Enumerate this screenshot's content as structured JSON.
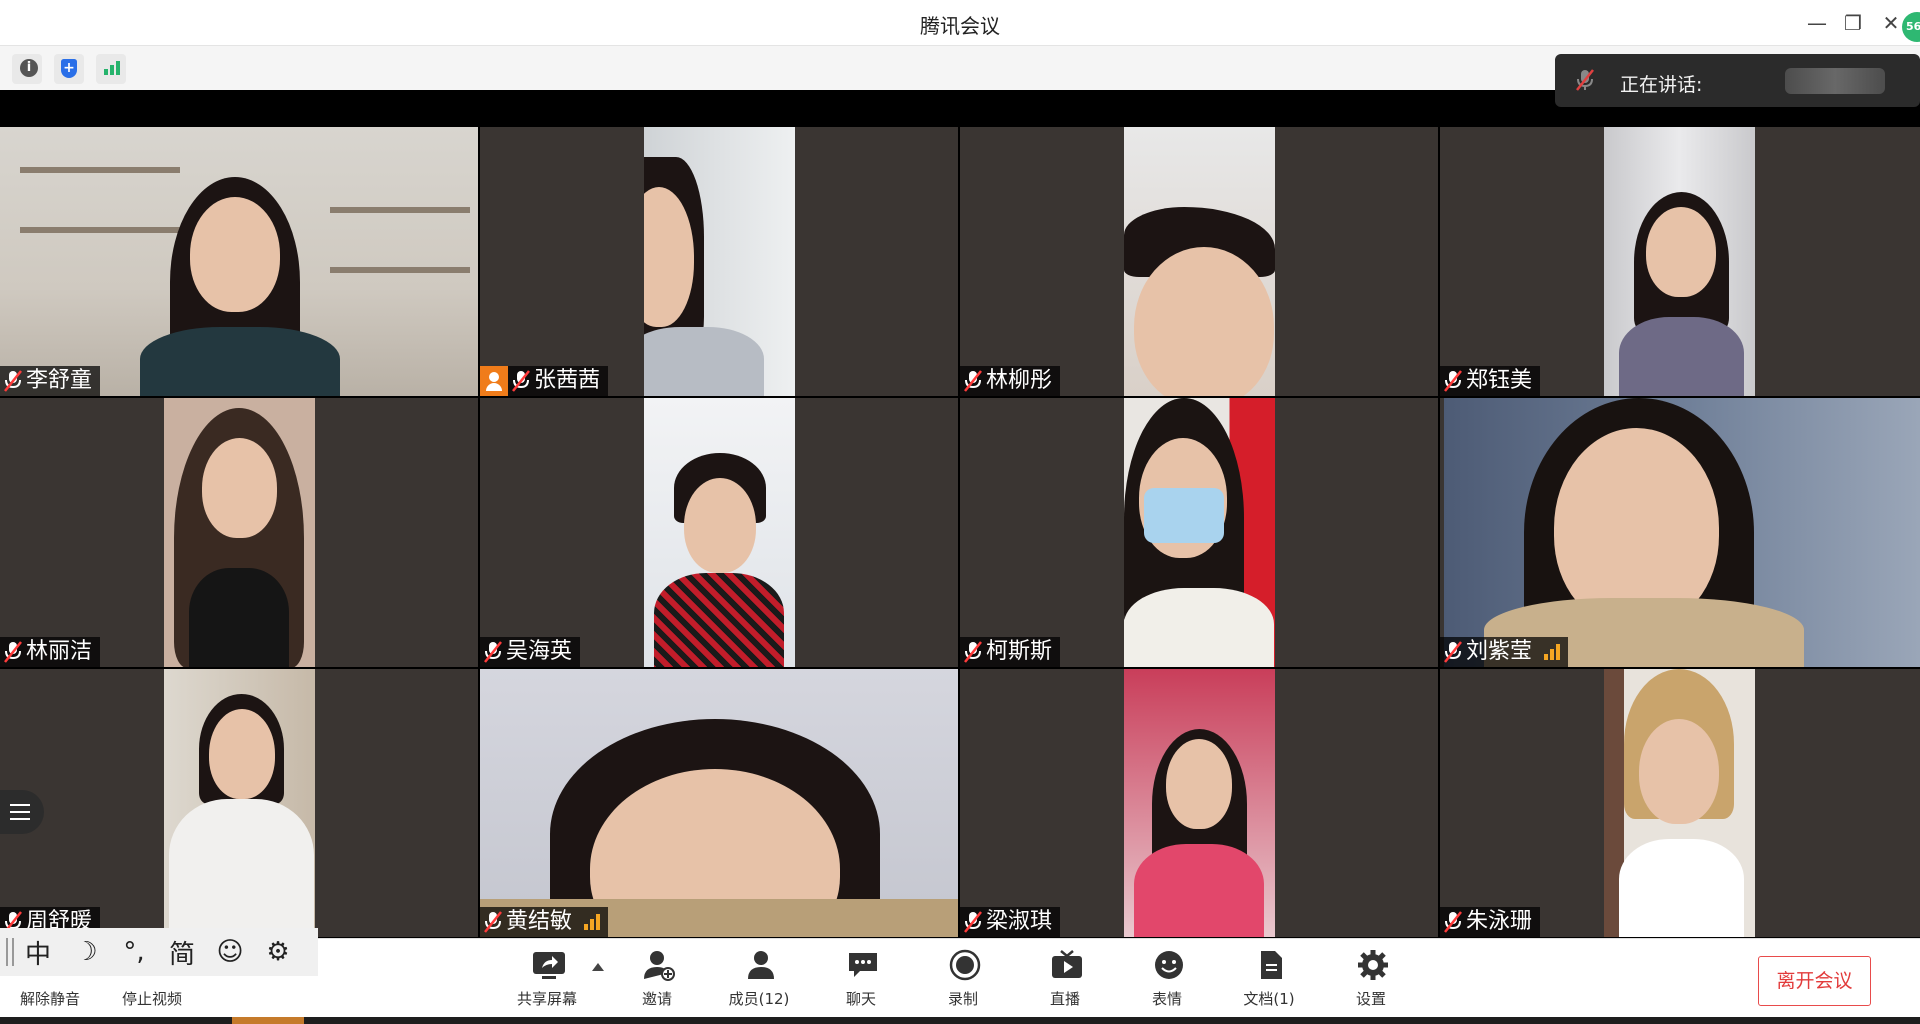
{
  "window": {
    "title": "腾讯会议"
  },
  "speaking": {
    "label": "正在讲话:"
  },
  "participants": [
    {
      "name": "李舒童",
      "host": false,
      "signal": false
    },
    {
      "name": "张茜茜",
      "host": true,
      "signal": false
    },
    {
      "name": "林柳彤",
      "host": false,
      "signal": false
    },
    {
      "name": "郑钰美",
      "host": false,
      "signal": false
    },
    {
      "name": "林丽洁",
      "host": false,
      "signal": false
    },
    {
      "name": "吴海英",
      "host": false,
      "signal": false
    },
    {
      "name": "柯斯斯",
      "host": false,
      "signal": false
    },
    {
      "name": "刘紫莹",
      "host": false,
      "signal": true
    },
    {
      "name": "周舒暖",
      "host": false,
      "signal": false
    },
    {
      "name": "黄结敏",
      "host": false,
      "signal": true
    },
    {
      "name": "梁淑琪",
      "host": false,
      "signal": false
    },
    {
      "name": "朱泳珊",
      "host": false,
      "signal": false
    }
  ],
  "ime": {
    "chinese": "中",
    "moon": "☽",
    "punct": "°,",
    "simplified": "简",
    "emoji": "☺",
    "settings": "⚙"
  },
  "toolbar": {
    "unmute": "解除静音",
    "stop_video": "停止视频",
    "share_screen": "共享屏幕",
    "invite": "邀请",
    "members": "成员(12)",
    "chat": "聊天",
    "record": "录制",
    "live": "直播",
    "reactions": "表情",
    "docs": "文档(1)",
    "settings": "设置",
    "leave": "离开会议"
  },
  "badge": {
    "text": "56"
  },
  "colors": {
    "accent_orange": "#f07c1a",
    "leave_red": "#e23b3b",
    "signal_green": "#26b36c",
    "tile_bg": "#3a3532"
  }
}
